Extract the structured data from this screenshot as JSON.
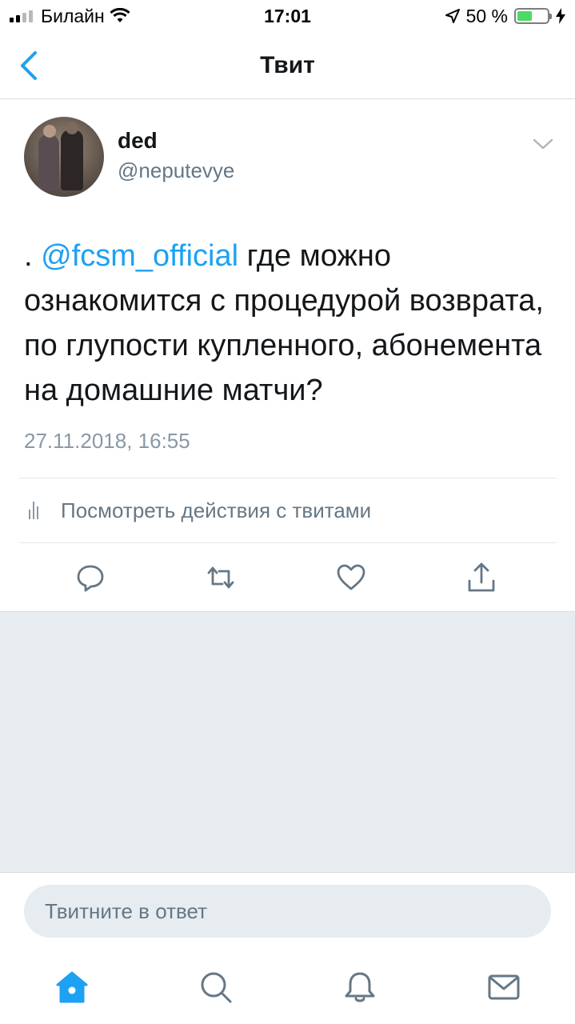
{
  "status_bar": {
    "carrier": "Билайн",
    "time": "17:01",
    "battery_percent": "50 %",
    "battery_level": 0.5
  },
  "nav": {
    "title": "Твит",
    "back_icon": "chevron-left-icon"
  },
  "tweet": {
    "author_name": "ded",
    "author_handle": "@neputevye",
    "text_prefix": ". ",
    "mention": "@fcsm_official",
    "text_rest": " где можно ознакомится с процедурой возврата, по глупости купленного, абонемента на домашние матчи?",
    "timestamp": "27.11.2018, 16:55",
    "analytics_label": "Посмотреть действия с твитами"
  },
  "actions": [
    "reply-icon",
    "retweet-icon",
    "like-icon",
    "share-icon"
  ],
  "reply": {
    "placeholder": "Твитните в ответ"
  },
  "tab_bar": {
    "tabs": [
      "home-icon",
      "search-icon",
      "notifications-icon",
      "messages-icon"
    ],
    "active": "home-icon"
  },
  "colors": {
    "accent": "#1da1f2",
    "secondary_text": "#657786",
    "background_gray": "#e6ecf0"
  }
}
